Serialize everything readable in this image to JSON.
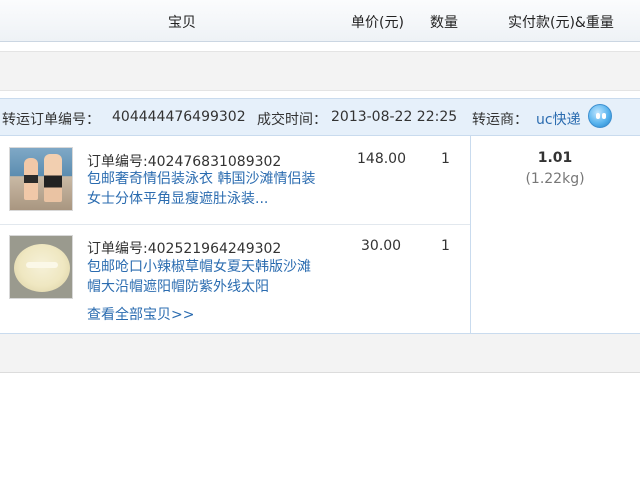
{
  "table_header": {
    "item": "宝贝",
    "unit_price": "单价(元)",
    "quantity": "数量",
    "total_weight": "实付款(元)&重量"
  },
  "order": {
    "transfer_label": "转运订单编号：",
    "transfer_number": "404444476499302",
    "time_label": "成交时间：",
    "time_value": "2013-08-22 22:25",
    "carrier_label": "转运商：",
    "carrier_name": "uc快递",
    "total_amount": "1.01",
    "total_weight": "(1.22kg)",
    "items": [
      {
        "order_number": "订单编号:402476831089302",
        "title": "包邮奢奇情侣装泳衣 韩国沙滩情侣装女士分体平角显瘦遮肚泳装...",
        "price": "148.00",
        "quantity": "1",
        "thumbnail_icon": "couple-swimwear-thumbnail"
      },
      {
        "order_number": "订单编号:402521964249302",
        "title": "包邮呛口小辣椒草帽女夏天韩版沙滩帽大沿帽遮阳帽防紫外线太阳",
        "price": "30.00",
        "quantity": "1",
        "thumbnail_icon": "straw-hat-thumbnail"
      }
    ],
    "view_all": "查看全部宝贝>>"
  },
  "colors": {
    "link": "#2b6cb0",
    "order_head_bg": "#e6f0fa",
    "border": "#c9dbee"
  }
}
